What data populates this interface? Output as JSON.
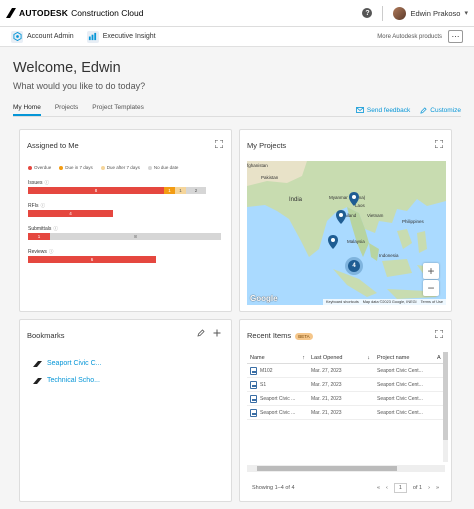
{
  "header": {
    "brand": "AUTODESK",
    "product": "Construction Cloud",
    "help_label": "?",
    "user_name": "Edwin Prakoso"
  },
  "appbar": {
    "items": [
      {
        "label": "Account Admin",
        "icon": "hexagon-icon"
      },
      {
        "label": "Executive Insight",
        "icon": "chart-icon"
      }
    ],
    "more_products": "More Autodesk products",
    "menu_label": "⋯"
  },
  "welcome": {
    "title": "Welcome, Edwin",
    "subtitle": "What would you like to do today?"
  },
  "tabs": [
    {
      "label": "My Home",
      "active": true
    },
    {
      "label": "Projects",
      "active": false
    },
    {
      "label": "Project Templates",
      "active": false
    }
  ],
  "actions": {
    "send_feedback": "Send feedback",
    "customize": "Customize"
  },
  "assigned": {
    "title": "Assigned to Me",
    "legend": [
      {
        "label": "Overdue",
        "color": "#e5473f"
      },
      {
        "label": "Due in 7 days",
        "color": "#f39c12"
      },
      {
        "label": "Due after 7 days",
        "color": "#f5d59a"
      },
      {
        "label": "No due date",
        "color": "#d6d6d6"
      }
    ],
    "metrics": [
      {
        "label": "Issues",
        "count_info": "ⓘ",
        "segments": [
          {
            "value": "8",
            "color": "#e5473f"
          },
          {
            "value": "1",
            "color": "#f39c12"
          },
          {
            "value": "1",
            "color": "#f5d59a"
          },
          {
            "value": "2",
            "color": "#d6d6d6"
          }
        ]
      },
      {
        "label": "RFIs",
        "count_info": "ⓘ",
        "segments": [
          {
            "value": "4",
            "color": "#e5473f"
          }
        ]
      },
      {
        "label": "Submittals",
        "count_info": "ⓘ",
        "segments": [
          {
            "value": "1",
            "color": "#e5473f"
          },
          {
            "value": "8",
            "color": "#d6d6d6"
          }
        ]
      },
      {
        "label": "Reviews",
        "count_info": "ⓘ",
        "segments": [
          {
            "value": "6",
            "color": "#e5473f"
          }
        ]
      }
    ]
  },
  "projects": {
    "title": "My Projects",
    "cluster_count": "4",
    "map_labels": {
      "afghanistan": "fghanistan",
      "pakistan": "Pakistan",
      "india": "India",
      "myanmar": "Myanmar (Burma)",
      "laos": "Laos",
      "thailand": "Thailand",
      "vietnam": "Vietnam",
      "philippines": "Philippines",
      "malaysia": "Malaysia",
      "indonesia": "Indonesia"
    },
    "zoom_in": "+",
    "zoom_out": "−",
    "google": "Google",
    "footer": [
      "Keyboard shortcuts",
      "Map data ©2023 Google, INEGI",
      "Terms of Use"
    ]
  },
  "bookmarks": {
    "title": "Bookmarks",
    "items": [
      "Seaport Civic C...",
      "Technical Scho..."
    ]
  },
  "recent": {
    "title": "Recent Items",
    "badge": "BETA",
    "columns": [
      "Name",
      "Last Opened",
      "Project name",
      "A"
    ],
    "rows": [
      {
        "name": "M102",
        "opened": "Mar. 27, 2023",
        "project": "Seaport Civic Cent..."
      },
      {
        "name": "S1",
        "opened": "Mar. 27, 2023",
        "project": "Seaport Civic Cent..."
      },
      {
        "name": "Seaport Civic ...",
        "opened": "Mar. 21, 2023",
        "project": "Seaport Civic Cent..."
      },
      {
        "name": "Seaport Civic ...",
        "opened": "Mar. 21, 2023",
        "project": "Seaport Civic Cent..."
      }
    ],
    "showing": "Showing 1–4 of 4",
    "page": "1",
    "of_pages": "of 1"
  }
}
